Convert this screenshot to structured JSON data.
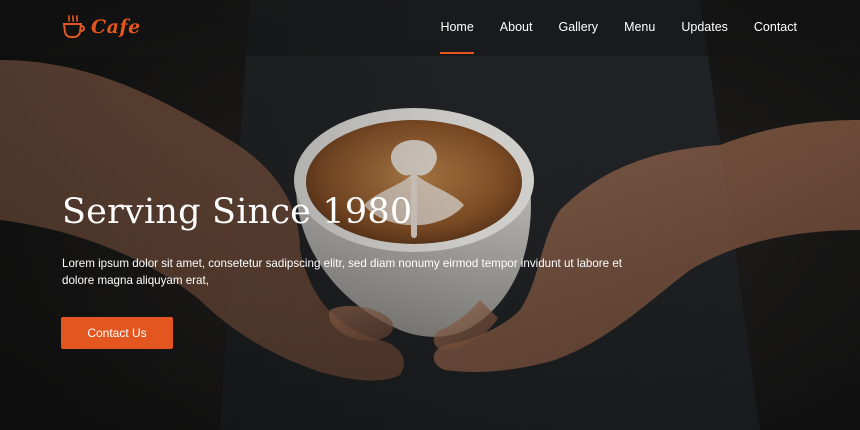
{
  "brand": {
    "name": "Cafe",
    "icon": "coffee-cup-icon",
    "color": "#e4561f"
  },
  "nav": {
    "items": [
      {
        "label": "Home",
        "active": true
      },
      {
        "label": "About"
      },
      {
        "label": "Gallery"
      },
      {
        "label": "Menu"
      },
      {
        "label": "Updates"
      },
      {
        "label": "Contact"
      }
    ]
  },
  "hero": {
    "title": "Serving Since 1980",
    "text": "Lorem ipsum dolor sit amet, consetetur sadipscing elitr, sed diam nonumy eirmod tempor invidunt ut labore et dolore magna aliquyam erat,",
    "cta_label": "Contact Us",
    "background": "latte-art-photo"
  },
  "colors": {
    "accent": "#e4561f",
    "text": "#ffffff",
    "nav_bg": "#141414"
  }
}
